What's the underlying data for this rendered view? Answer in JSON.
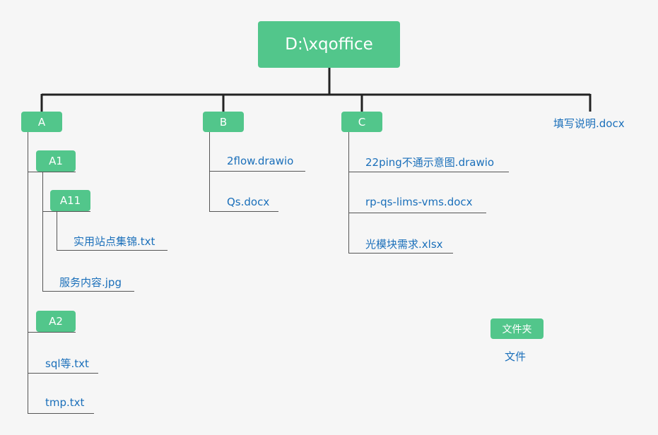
{
  "colors": {
    "folder": "#52c68b",
    "file_text": "#1a6fba",
    "line_dark": "#222222",
    "line_light": "#555555"
  },
  "root": {
    "label": "D:\\xqoffice"
  },
  "folders": {
    "A": "A",
    "A1": "A1",
    "A11": "A11",
    "A2": "A2",
    "B": "B",
    "C": "C"
  },
  "files": {
    "readme": "填写说明.docx",
    "a11_file": "实用站点集锦.txt",
    "a1_file": "服务内容.jpg",
    "a2_file1": "sql等.txt",
    "a2_file2": "tmp.txt",
    "b_file1": "2flow.drawio",
    "b_file2": "Qs.docx",
    "c_file1": "22ping不通示意图.drawio",
    "c_file2": "rp-qs-lims-vms.docx",
    "c_file3": "光模块需求.xlsx"
  },
  "legend": {
    "folder_label": "文件夹",
    "file_label": "文件"
  }
}
